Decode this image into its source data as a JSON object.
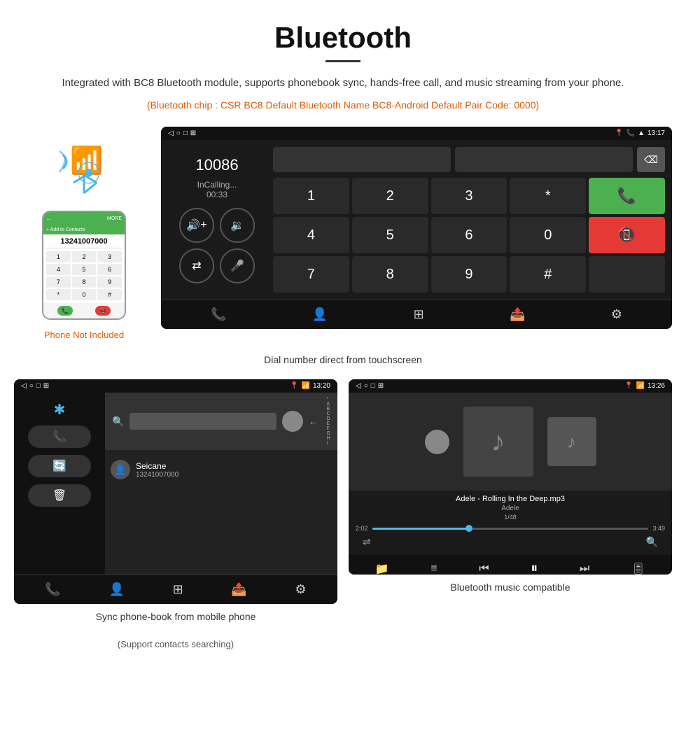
{
  "page": {
    "title": "Bluetooth",
    "description": "Integrated with BC8 Bluetooth module, supports phonebook sync, hands-free call, and music streaming from your phone.",
    "specs": "(Bluetooth chip : CSR BC8    Default Bluetooth Name BC8-Android    Default Pair Code: 0000)",
    "phone_not_included": "Phone Not Included",
    "dial_caption": "Dial number direct from touchscreen",
    "phonebook_caption": "Sync phone-book from mobile phone",
    "phonebook_sub_caption": "(Support contacts searching)",
    "music_caption": "Bluetooth music compatible"
  },
  "dial_screen": {
    "status_time": "13:17",
    "phone_number": "10086",
    "call_status": "InCalling...",
    "call_timer": "00:33",
    "keys": [
      "1",
      "2",
      "3",
      "*",
      "",
      "4",
      "5",
      "6",
      "0",
      "",
      "7",
      "8",
      "9",
      "#",
      ""
    ]
  },
  "phonebook_screen": {
    "status_time": "13:20",
    "contact_name": "Seicane",
    "contact_number": "13241007000",
    "alphabet": [
      "*",
      "A",
      "B",
      "C",
      "D",
      "E",
      "F",
      "G",
      "H",
      "I"
    ]
  },
  "music_screen": {
    "status_time": "13:26",
    "song_title": "Adele - Rolling In the Deep.mp3",
    "artist": "Adele",
    "track": "1/48",
    "time_current": "2:02",
    "time_total": "3:49",
    "progress_percent": 35
  }
}
